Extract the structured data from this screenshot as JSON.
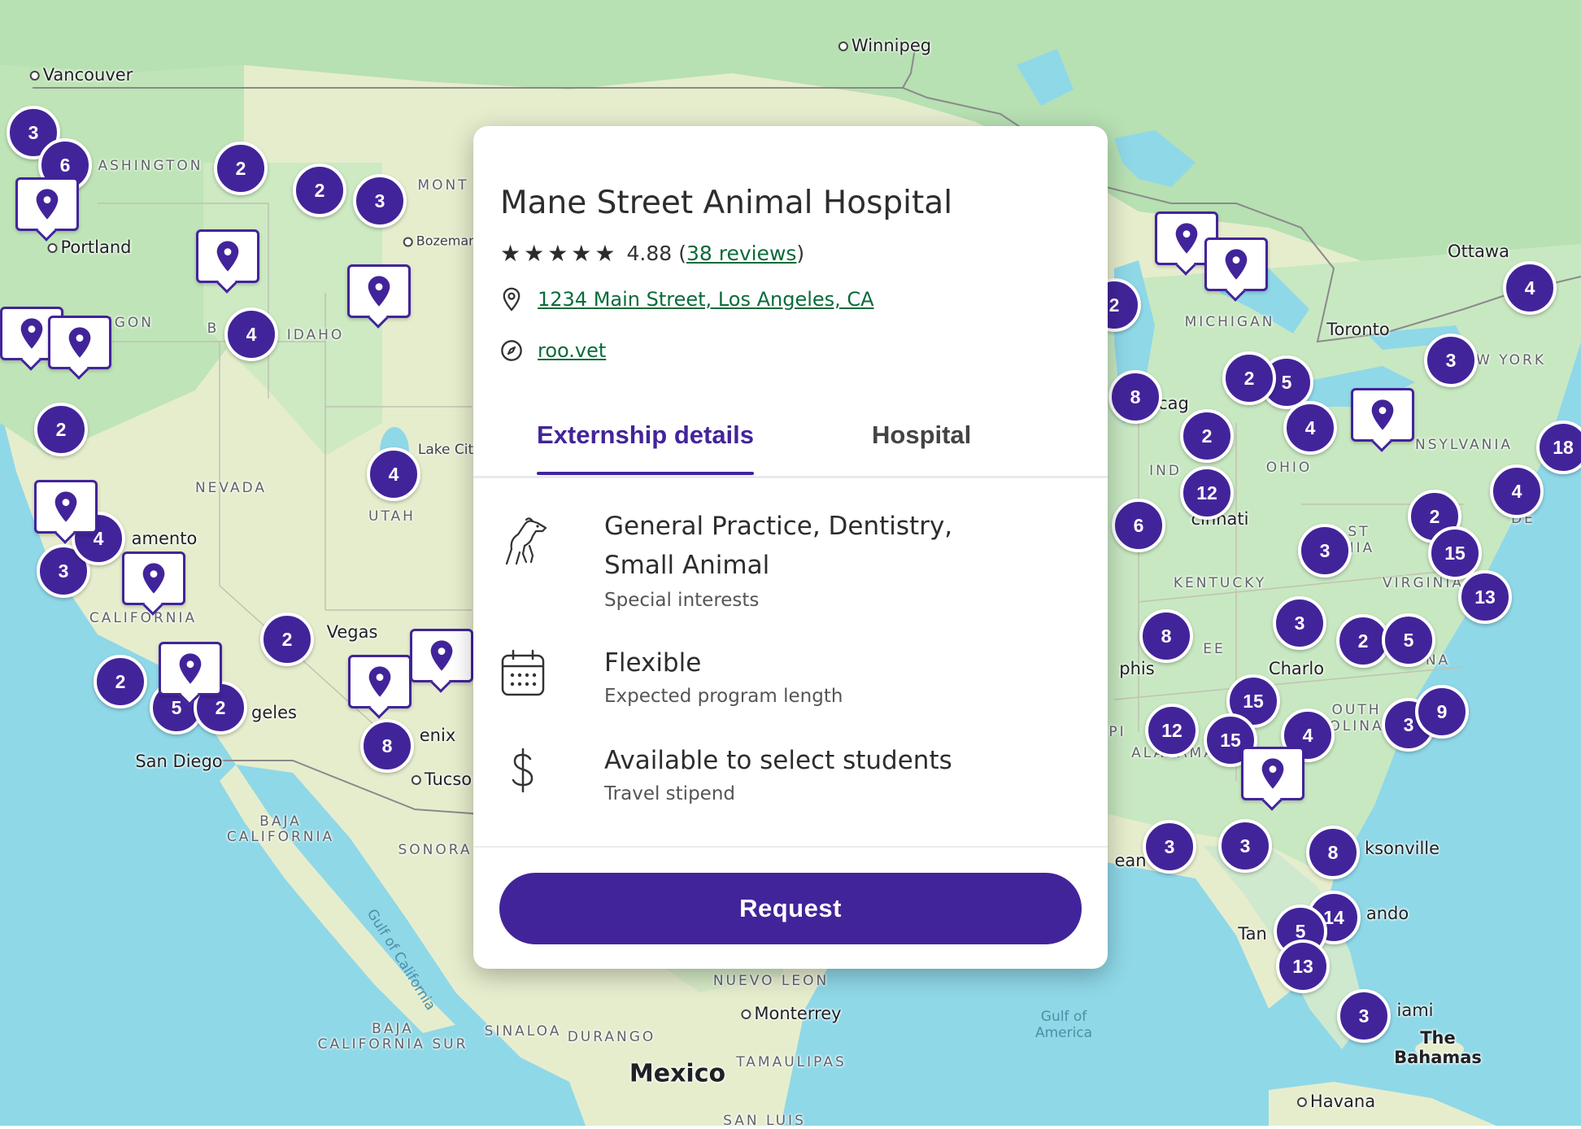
{
  "map": {
    "labels": {
      "vancouver": "Vancouver",
      "winnipeg": "Winnipeg",
      "washington": "ASHINGTON",
      "montana": "MONT",
      "bozeman": "Bozeman",
      "portland": "Portland",
      "oregon": "EGON",
      "idaho": "IDAHO",
      "idaho_prefix": "B",
      "nevada": "NEVADA",
      "utah": "UTAH",
      "lake_city": "Lake Cit",
      "sacramento": "amento",
      "california": "CALIFORNIA",
      "vegas": "Vegas",
      "los_angeles": "geles",
      "san_diego": "San Diego",
      "phoenix": "enix",
      "tucson": "Tucso",
      "baja_california": "BAJA\nCALIFORNIA",
      "sonora": "SONORA",
      "gulf_california": "Gulf of California",
      "baja_california_sur": "BAJA\nCALIFORNIA SUR",
      "sinaloa": "SINALOA",
      "durango": "DURANGO",
      "nuevo_leon": "NUEVO LEON",
      "monterrey": "Monterrey",
      "mexico": "Mexico",
      "tamaulipas": "TAMAULIPAS",
      "san_luis": "SAN LUIS",
      "gulf_america": "Gulf of\nAmerica",
      "havana": "Havana",
      "bahamas": "The\nBahamas",
      "miami": "iami",
      "orlando": "ando",
      "tampa": "Tan",
      "jacksonville": "ksonville",
      "charlotte": "Charlo",
      "virginia": "VIRGINIA",
      "kentucky": "KENTUCKY",
      "ohio": "OHIO",
      "indiana": "IND",
      "cincinnati": "cinnati",
      "michigan": "MICHIGAN",
      "toronto": "Toronto",
      "ottawa": "Ottawa",
      "new_york": "W YORK",
      "pennsylvania": "NSYLVANIA",
      "alabama": "ALABAMA",
      "tennessee": "EE",
      "memphis": "phis",
      "new_orleans": "ean",
      "mississippi": "PI",
      "carolina_n": "NA",
      "carolina_s": "OUTH\nOLINA",
      "west_virginia": "ST\nNIA",
      "maryland": "YLA\nDE",
      "chicago": "icag"
    },
    "clusters": [
      "3",
      "6",
      "2",
      "2",
      "3",
      "4",
      "2",
      "4",
      "3",
      "4",
      "2",
      "2",
      "5",
      "2",
      "8",
      "2",
      "8",
      "12",
      "6",
      "2",
      "5",
      "4",
      "2",
      "3",
      "4",
      "18",
      "4",
      "2",
      "15",
      "13",
      "3",
      "3",
      "8",
      "2",
      "5",
      "12",
      "15",
      "15",
      "4",
      "3",
      "9",
      "3",
      "3",
      "8",
      "14",
      "5",
      "13",
      "3",
      "2"
    ]
  },
  "card": {
    "title": "Mane Street Animal Hospital",
    "stars": "★★★★★",
    "rating": "4.88",
    "paren_open": "(",
    "reviews": "38 reviews",
    "paren_close": ")",
    "address": "1234 Main Street, Los Angeles, CA",
    "website": "roo.vet",
    "tabs": [
      "Externship details",
      "Hospital"
    ],
    "details": [
      {
        "main": "General Practice, Dentistry,\nSmall Animal",
        "sub": "Special interests",
        "icon": "dog-icon"
      },
      {
        "main": "Flexible",
        "sub": "Expected program length",
        "icon": "calendar-icon"
      },
      {
        "main": "Available to select students",
        "sub": "Travel stipend",
        "icon": "dollar-icon"
      }
    ],
    "request_label": "Request"
  },
  "colors": {
    "accent": "#42249a",
    "link": "#0b6b3a",
    "water": "#8fd8e8",
    "land": "#e9efcf"
  }
}
